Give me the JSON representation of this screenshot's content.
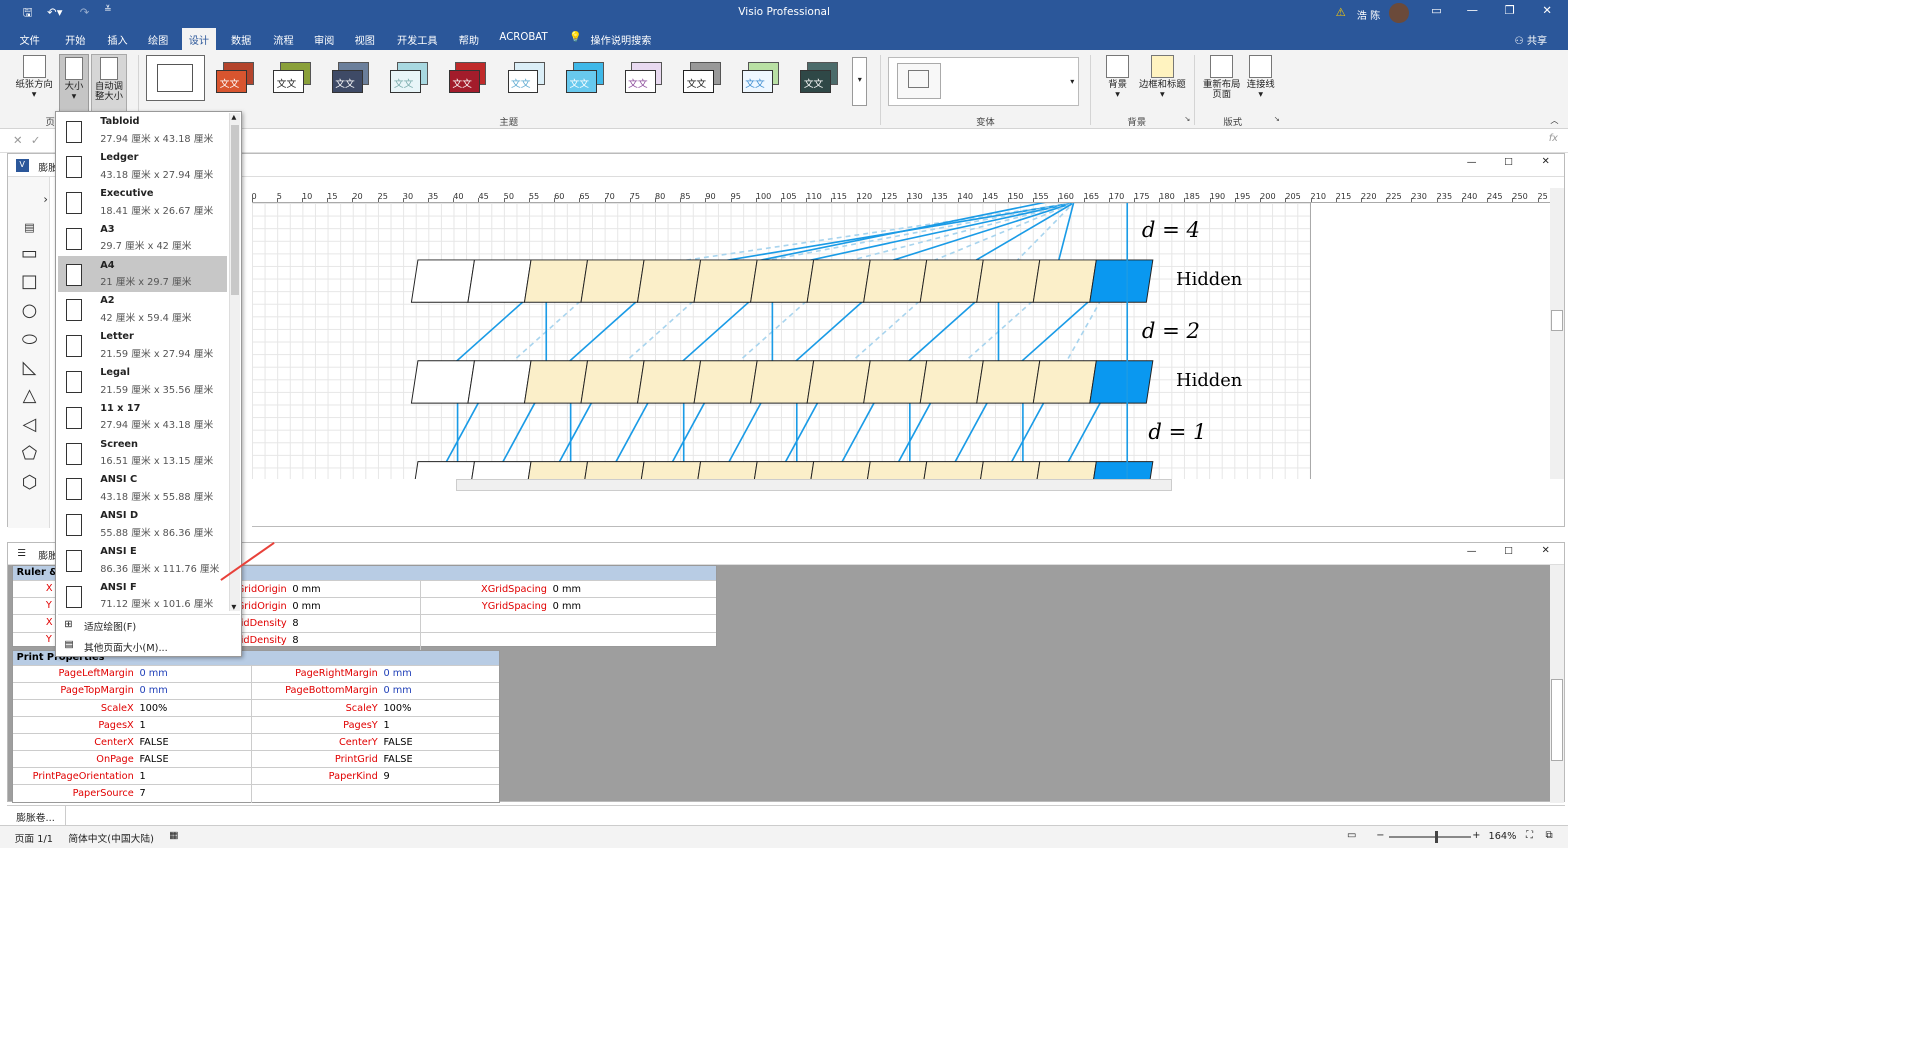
{
  "window": {
    "title": "Visio Professional",
    "user": "浩 陈"
  },
  "tabs": [
    "文件",
    "开始",
    "插入",
    "绘图",
    "设计",
    "数据",
    "流程",
    "审阅",
    "视图",
    "开发工具",
    "帮助",
    "ACROBAT"
  ],
  "active_tab": "设计",
  "tell_me": "操作说明搜索",
  "share": "共享",
  "ribbon": {
    "orientation": "纸张方向",
    "size": "大小",
    "autofit": "自动调整大小",
    "group_page": "页",
    "group_themes": "主题",
    "group_variants": "变体",
    "background": "背景",
    "borders": "边框和标题",
    "group_background": "背景",
    "relayout": "重新布局页面",
    "connectors": "连接线",
    "group_layout": "版式",
    "theme_text": "文文"
  },
  "drawing": {
    "window_title": "膨胀",
    "ruler_ticks": [
      "0",
      "5",
      "10",
      "15",
      "20",
      "25",
      "30",
      "35",
      "40",
      "45",
      "50",
      "55",
      "60",
      "65",
      "70",
      "75",
      "80",
      "85",
      "90",
      "95",
      "100",
      "105",
      "110",
      "115",
      "120",
      "125",
      "130",
      "135",
      "140",
      "145",
      "150",
      "155",
      "160",
      "165",
      "170",
      "175",
      "180",
      "185",
      "190",
      "195",
      "200",
      "205",
      "210",
      "215",
      "220",
      "225",
      "230",
      "235",
      "240",
      "245",
      "250",
      "25"
    ],
    "labels": {
      "d4": "d = 4",
      "hidden1": "Hidden",
      "d2": "d = 2",
      "hidden2": "Hidden",
      "d1": "d = 1"
    }
  },
  "sheet": {
    "window_title": "膨胀",
    "ruler_section": "Ruler &",
    "ruler_rows": [
      {
        "n1": "XGridOrigin",
        "v1": "0 mm",
        "n2": "XGridSpacing",
        "v2": "0 mm"
      },
      {
        "n1": "YGridOrigin",
        "v1": "0 mm",
        "n2": "YGridSpacing",
        "v2": "0 mm"
      },
      {
        "n1": "XGridDensity",
        "v1": "8"
      },
      {
        "n1": "YGridDensity",
        "v1": "8"
      }
    ],
    "left_stub": [
      "X",
      "Y",
      "X",
      "Y"
    ],
    "print_section": "Print Properties",
    "print_rows": [
      {
        "n1": "PageLeftMargin",
        "v1": "0 mm",
        "n2": "PageRightMargin",
        "v2": "0 mm"
      },
      {
        "n1": "PageTopMargin",
        "v1": "0 mm",
        "n2": "PageBottomMargin",
        "v2": "0 mm"
      },
      {
        "n1": "ScaleX",
        "v1": "100%",
        "n2": "ScaleY",
        "v2": "100%"
      },
      {
        "n1": "PagesX",
        "v1": "1",
        "n2": "PagesY",
        "v2": "1"
      },
      {
        "n1": "CenterX",
        "v1": "FALSE",
        "n2": "CenterY",
        "v2": "FALSE"
      },
      {
        "n1": "OnPage",
        "v1": "FALSE",
        "n2": "PrintGrid",
        "v2": "FALSE"
      },
      {
        "n1": "PrintPageOrientation",
        "v1": "1",
        "n2": "PaperKind",
        "v2": "9"
      },
      {
        "n1": "PaperSource",
        "v1": "7"
      }
    ]
  },
  "size_menu": {
    "items": [
      {
        "name": "Tabloid",
        "size": "27.94 厘米 x 43.18 厘米"
      },
      {
        "name": "Ledger",
        "size": "43.18 厘米 x 27.94 厘米"
      },
      {
        "name": "Executive",
        "size": "18.41 厘米 x 26.67 厘米"
      },
      {
        "name": "A3",
        "size": "29.7 厘米 x 42 厘米"
      },
      {
        "name": "A4",
        "size": "21 厘米 x 29.7 厘米"
      },
      {
        "name": "A2",
        "size": "42 厘米 x 59.4 厘米"
      },
      {
        "name": "Letter",
        "size": "21.59 厘米 x 27.94 厘米"
      },
      {
        "name": "Legal",
        "size": "21.59 厘米 x 35.56 厘米"
      },
      {
        "name": "11 x 17",
        "size": "27.94 厘米 x 43.18 厘米"
      },
      {
        "name": "Screen",
        "size": "16.51 厘米 x 13.15 厘米"
      },
      {
        "name": "ANSI C",
        "size": "43.18 厘米 x 55.88 厘米"
      },
      {
        "name": "ANSI D",
        "size": "55.88 厘米 x 86.36 厘米"
      },
      {
        "name": "ANSI E",
        "size": "86.36 厘米 x 111.76 厘米"
      },
      {
        "name": "ANSI F",
        "size": "71.12 厘米 x 101.6 厘米"
      }
    ],
    "selected": "A4",
    "fit": "适应绘图(F)",
    "more": "其他页面大小(M)..."
  },
  "status": {
    "page": "页面 1/1",
    "language": "简体中文(中国大陆)",
    "zoom": "164%",
    "page_tab": "膨胀卷..."
  },
  "colors": {
    "accent": "#2b579a",
    "cell_fill": "#fbefc9",
    "hidden_blue": "#0a98f0",
    "line_blue": "#1a9be6"
  }
}
